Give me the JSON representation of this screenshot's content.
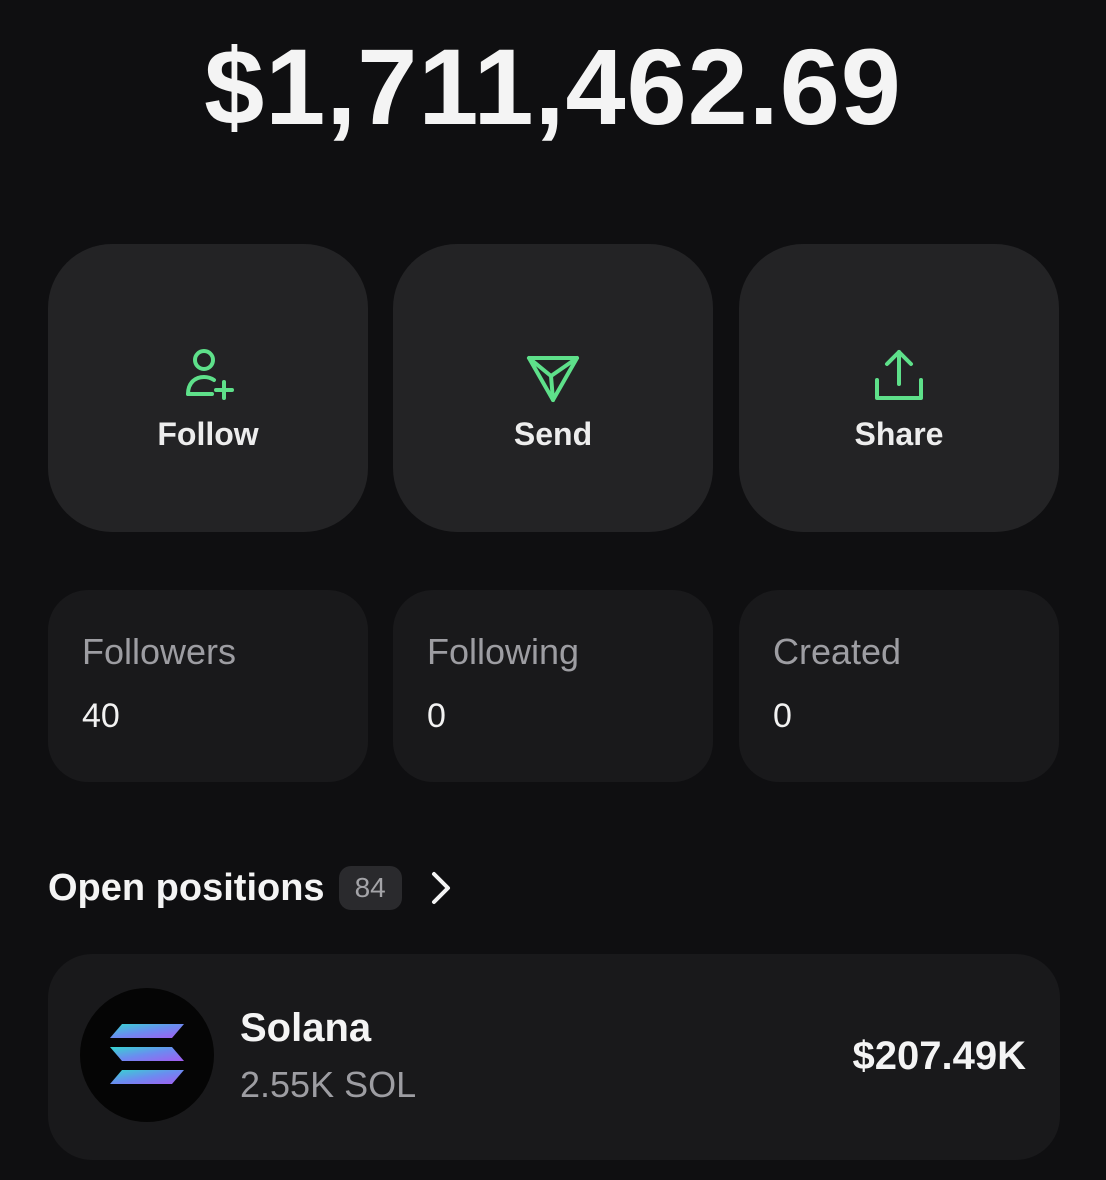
{
  "balance": "$1,711,462.69",
  "actions": [
    {
      "label": "Follow",
      "icon": "user-plus-icon"
    },
    {
      "label": "Send",
      "icon": "send-icon"
    },
    {
      "label": "Share",
      "icon": "share-icon"
    }
  ],
  "stats": [
    {
      "label": "Followers",
      "value": "40"
    },
    {
      "label": "Following",
      "value": "0"
    },
    {
      "label": "Created",
      "value": "0"
    }
  ],
  "open_positions": {
    "title": "Open positions",
    "count": "84",
    "items": [
      {
        "name": "Solana",
        "amount": "2.55K SOL",
        "value": "$207.49K",
        "icon": "solana-logo-icon"
      }
    ]
  },
  "colors": {
    "background": "#0f0f11",
    "action_card": "#232325",
    "stat_card": "#19191b",
    "accent_green": "#5ee08a",
    "muted_text": "#9d9da2"
  }
}
